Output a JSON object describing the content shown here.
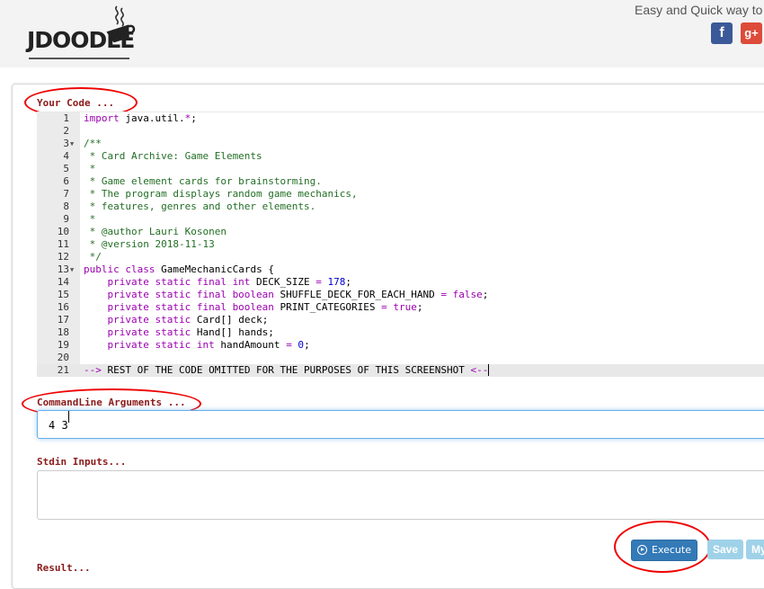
{
  "header": {
    "logo_text": "JDOODLE",
    "tagline": "Easy and Quick way to",
    "facebook_glyph": "f",
    "googleplus_glyph": "g+"
  },
  "code_section": {
    "label": "Your Code ..."
  },
  "editor": {
    "line_numbers": [
      "1",
      "2",
      "3",
      "4",
      "5",
      "6",
      "7",
      "8",
      "9",
      "10",
      "11",
      "12",
      "13",
      "14",
      "15",
      "16",
      "17",
      "18",
      "19",
      "20",
      "21"
    ],
    "lines": [
      {
        "n": "1",
        "fold": false,
        "tokens": [
          {
            "c": "kw",
            "t": "import"
          },
          {
            "c": "",
            "t": " java.util."
          },
          {
            "c": "kw",
            "t": "*"
          },
          {
            "c": "",
            "t": ";"
          }
        ]
      },
      {
        "n": "2",
        "fold": false,
        "tokens": []
      },
      {
        "n": "3",
        "fold": true,
        "tokens": [
          {
            "c": "cmt",
            "t": "/**"
          }
        ]
      },
      {
        "n": "4",
        "fold": false,
        "tokens": [
          {
            "c": "cmt",
            "t": " * Card Archive: Game Elements"
          }
        ]
      },
      {
        "n": "5",
        "fold": false,
        "tokens": [
          {
            "c": "cmt",
            "t": " *"
          }
        ]
      },
      {
        "n": "6",
        "fold": false,
        "tokens": [
          {
            "c": "cmt",
            "t": " * Game element cards for brainstorming."
          }
        ]
      },
      {
        "n": "7",
        "fold": false,
        "tokens": [
          {
            "c": "cmt",
            "t": " * The program displays random game mechanics,"
          }
        ]
      },
      {
        "n": "8",
        "fold": false,
        "tokens": [
          {
            "c": "cmt",
            "t": " * features, genres and other elements."
          }
        ]
      },
      {
        "n": "9",
        "fold": false,
        "tokens": [
          {
            "c": "cmt",
            "t": " *"
          }
        ]
      },
      {
        "n": "10",
        "fold": false,
        "tokens": [
          {
            "c": "cmt",
            "t": " * @author Lauri Kosonen"
          }
        ]
      },
      {
        "n": "11",
        "fold": false,
        "tokens": [
          {
            "c": "cmt",
            "t": " * @version 2018-11-13"
          }
        ]
      },
      {
        "n": "12",
        "fold": false,
        "tokens": [
          {
            "c": "cmt",
            "t": " */"
          }
        ]
      },
      {
        "n": "13",
        "fold": true,
        "tokens": [
          {
            "c": "kw",
            "t": "public class"
          },
          {
            "c": "",
            "t": " GameMechanicCards {"
          }
        ]
      },
      {
        "n": "14",
        "fold": false,
        "tokens": [
          {
            "c": "kw",
            "t": "    private static final int"
          },
          {
            "c": "",
            "t": " DECK_SIZE "
          },
          {
            "c": "kw",
            "t": "="
          },
          {
            "c": "num",
            "t": " 178"
          },
          {
            "c": "",
            "t": ";"
          }
        ]
      },
      {
        "n": "15",
        "fold": false,
        "tokens": [
          {
            "c": "kw",
            "t": "    private static final boolean"
          },
          {
            "c": "",
            "t": " SHUFFLE_DECK_FOR_EACH_HAND "
          },
          {
            "c": "kw",
            "t": "= false"
          },
          {
            "c": "",
            "t": ";"
          }
        ]
      },
      {
        "n": "16",
        "fold": false,
        "tokens": [
          {
            "c": "kw",
            "t": "    private static final boolean"
          },
          {
            "c": "",
            "t": " PRINT_CATEGORIES "
          },
          {
            "c": "kw",
            "t": "= true"
          },
          {
            "c": "",
            "t": ";"
          }
        ]
      },
      {
        "n": "17",
        "fold": false,
        "tokens": [
          {
            "c": "kw",
            "t": "    private static"
          },
          {
            "c": "",
            "t": " Card[] deck;"
          }
        ]
      },
      {
        "n": "18",
        "fold": false,
        "tokens": [
          {
            "c": "kw",
            "t": "    private static"
          },
          {
            "c": "",
            "t": " Hand[] hands;"
          }
        ]
      },
      {
        "n": "19",
        "fold": false,
        "tokens": [
          {
            "c": "kw",
            "t": "    private static int"
          },
          {
            "c": "",
            "t": " handAmount "
          },
          {
            "c": "kw",
            "t": "="
          },
          {
            "c": "num",
            "t": " 0"
          },
          {
            "c": "",
            "t": ";"
          }
        ]
      },
      {
        "n": "20",
        "fold": false,
        "tokens": []
      },
      {
        "n": "21",
        "fold": false,
        "active": true,
        "tokens": [
          {
            "c": "kw",
            "t": "-->"
          },
          {
            "c": "",
            "t": " REST OF THE CODE OMITTED FOR THE PURPOSES OF THIS SCREENSHOT "
          },
          {
            "c": "kw",
            "t": "<--"
          }
        ]
      }
    ]
  },
  "args_section": {
    "label": "CommandLine Arguments ...",
    "value": "4 3"
  },
  "stdin_section": {
    "label": "Stdin Inputs...",
    "value": ""
  },
  "buttons": {
    "execute": "Execute",
    "save": "Save",
    "my": "My"
  },
  "result_section": {
    "label": "Result..."
  },
  "colors": {
    "keyword": "#9b00b0",
    "comment": "#236e25",
    "number": "#0000cd",
    "label": "#8b1a1a",
    "execute_bg": "#337ab7",
    "save_bg": "#9fd2e8",
    "annotation": "#ee0000"
  }
}
